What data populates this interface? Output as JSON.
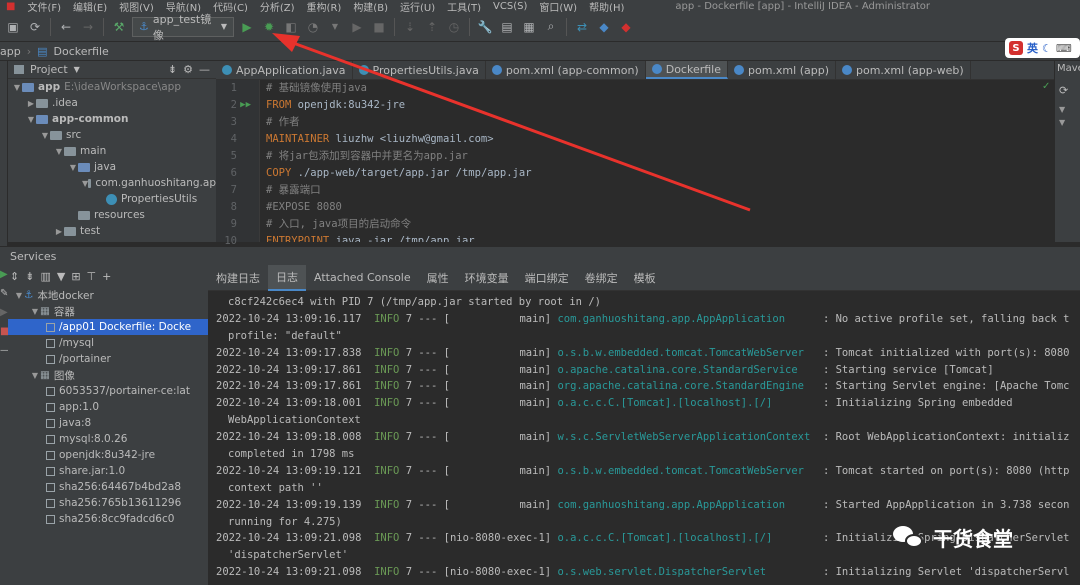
{
  "menu": {
    "items": [
      "文件(F)",
      "编辑(E)",
      "视图(V)",
      "导航(N)",
      "代码(C)",
      "分析(Z)",
      "重构(R)",
      "构建(B)",
      "运行(U)",
      "工具(T)",
      "VCS(S)",
      "窗口(W)",
      "帮助(H)"
    ],
    "window_title": "app - Dockerfile [app] - IntelliJ IDEA - Administrator"
  },
  "toolbar": {
    "run_config": "app_test镜像",
    "icons": [
      "save-icon",
      "sync-icon",
      "back-icon",
      "forward-icon",
      "build-icon",
      "run-icon",
      "debug-icon",
      "coverage-icon",
      "profile-icon",
      "stop-icon",
      "vcs-icon",
      "settings-icon",
      "structure-icon",
      "search-icon"
    ]
  },
  "breadcrumb": {
    "items": [
      "app",
      "Dockerfile"
    ]
  },
  "project": {
    "title": "Project",
    "tree": [
      {
        "label": "app",
        "extra": "E:\\ideaWorkspace\\app",
        "indent": 0,
        "open": true,
        "type": "folder-blue",
        "bold": true
      },
      {
        "label": ".idea",
        "indent": 1,
        "open": false,
        "type": "folder"
      },
      {
        "label": "app-common",
        "indent": 1,
        "open": true,
        "type": "folder-blue",
        "bold": true
      },
      {
        "label": "src",
        "indent": 2,
        "open": true,
        "type": "folder"
      },
      {
        "label": "main",
        "indent": 3,
        "open": true,
        "type": "folder"
      },
      {
        "label": "java",
        "indent": 4,
        "open": true,
        "type": "folder-blue"
      },
      {
        "label": "com.ganhuoshitang.ap",
        "indent": 5,
        "open": true,
        "type": "folder"
      },
      {
        "label": "PropertiesUtils",
        "indent": 6,
        "open": null,
        "type": "class"
      },
      {
        "label": "resources",
        "indent": 4,
        "open": null,
        "type": "folder"
      },
      {
        "label": "test",
        "indent": 3,
        "open": false,
        "type": "folder"
      }
    ]
  },
  "editor": {
    "tabs": [
      {
        "label": "AppApplication.java",
        "active": false,
        "color": "#3d8fb5"
      },
      {
        "label": "PropertiesUtils.java",
        "active": false,
        "color": "#3d8fb5"
      },
      {
        "label": "pom.xml (app-common)",
        "active": false,
        "color": "#4a88c7"
      },
      {
        "label": "Dockerfile",
        "active": true,
        "color": "#4a88c7"
      },
      {
        "label": "pom.xml (app)",
        "active": false,
        "color": "#4a88c7"
      },
      {
        "label": "pom.xml (app-web)",
        "active": false,
        "color": "#4a88c7"
      }
    ],
    "right_label": "Mave",
    "lines": [
      {
        "n": "1",
        "parts": [
          {
            "c": "cm",
            "t": "# 基础镜像使用java"
          }
        ]
      },
      {
        "n": "2",
        "run": true,
        "parts": [
          {
            "c": "kw",
            "t": "FROM"
          },
          {
            "c": "tx",
            "t": " openjdk:8u342-jre"
          }
        ]
      },
      {
        "n": "3",
        "parts": [
          {
            "c": "cm",
            "t": "# 作者"
          }
        ]
      },
      {
        "n": "4",
        "parts": [
          {
            "c": "kw",
            "t": "MAINTAINER"
          },
          {
            "c": "tx",
            "t": " liuzhw <liuzhw@gmail.com>"
          }
        ]
      },
      {
        "n": "5",
        "parts": [
          {
            "c": "cm",
            "t": "# 将jar包添加到容器中并更名为app.jar"
          }
        ]
      },
      {
        "n": "6",
        "parts": [
          {
            "c": "kw",
            "t": "COPY"
          },
          {
            "c": "tx",
            "t": " ./app-web/target/app.jar /tmp/app.jar"
          }
        ]
      },
      {
        "n": "7",
        "parts": [
          {
            "c": "cm",
            "t": "# 暴露端口"
          }
        ]
      },
      {
        "n": "8",
        "parts": [
          {
            "c": "cm",
            "t": "#EXPOSE 8080"
          }
        ]
      },
      {
        "n": "9",
        "parts": [
          {
            "c": "cm",
            "t": "# 入口, java项目的启动命令"
          }
        ]
      },
      {
        "n": "10",
        "parts": [
          {
            "c": "kw",
            "t": "ENTRYPOINT"
          },
          {
            "c": "tx",
            "t": " java -jar /tmp/app.jar"
          }
        ]
      }
    ]
  },
  "services": {
    "title": "Services",
    "tree": [
      {
        "label": "本地docker",
        "indent": 0,
        "type": "docker"
      },
      {
        "label": "容器",
        "indent": 1,
        "type": "group"
      },
      {
        "label": "/app01 Dockerfile: Docke",
        "indent": 2,
        "type": "item",
        "selected": true
      },
      {
        "label": "/mysql",
        "indent": 2,
        "type": "item"
      },
      {
        "label": "/portainer",
        "indent": 2,
        "type": "item"
      },
      {
        "label": "图像",
        "indent": 1,
        "type": "group"
      },
      {
        "label": "6053537/portainer-ce:lat",
        "indent": 2,
        "type": "item"
      },
      {
        "label": "app:1.0",
        "indent": 2,
        "type": "item"
      },
      {
        "label": "java:8",
        "indent": 2,
        "type": "item"
      },
      {
        "label": "mysql:8.0.26",
        "indent": 2,
        "type": "item"
      },
      {
        "label": "openjdk:8u342-jre",
        "indent": 2,
        "type": "item"
      },
      {
        "label": "share.jar:1.0",
        "indent": 2,
        "type": "item"
      },
      {
        "label": "sha256:64467b4bd2a8",
        "indent": 2,
        "type": "item"
      },
      {
        "label": "sha256:765b13611296",
        "indent": 2,
        "type": "item"
      },
      {
        "label": "sha256:8cc9fadcd6c0",
        "indent": 2,
        "type": "item"
      }
    ],
    "tabs": [
      {
        "label": "构建日志",
        "active": false
      },
      {
        "label": "日志",
        "active": true
      },
      {
        "label": "Attached Console",
        "active": false
      },
      {
        "label": "属性",
        "active": false
      },
      {
        "label": "环境变量",
        "active": false
      },
      {
        "label": "端口绑定",
        "active": false
      },
      {
        "label": "卷绑定",
        "active": false
      },
      {
        "label": "模板",
        "active": false
      }
    ],
    "log": [
      {
        "t": "c8cf242c6ec4 with PID 7 (/tmp/app.jar started by root in /)",
        "cont": true
      },
      {
        "ts": "2022-10-24 13:09:16.117",
        "lvl": "INFO",
        "pid": "7 --- [",
        "th": "           main]",
        "cls": "com.ganhuoshitang.app.AppApplication     ",
        "msg": ": No active profile set, falling back t"
      },
      {
        "t": "profile: \"default\"",
        "cont": true
      },
      {
        "ts": "2022-10-24 13:09:17.838",
        "lvl": "INFO",
        "pid": "7 --- [",
        "th": "           main]",
        "cls": "o.s.b.w.embedded.tomcat.TomcatWebServer  ",
        "msg": ": Tomcat initialized with port(s): 8080"
      },
      {
        "ts": "2022-10-24 13:09:17.861",
        "lvl": "INFO",
        "pid": "7 --- [",
        "th": "           main]",
        "cls": "o.apache.catalina.core.StandardService   ",
        "msg": ": Starting service [Tomcat]"
      },
      {
        "ts": "2022-10-24 13:09:17.861",
        "lvl": "INFO",
        "pid": "7 --- [",
        "th": "           main]",
        "cls": "org.apache.catalina.core.StandardEngine  ",
        "msg": ": Starting Servlet engine: [Apache Tomc"
      },
      {
        "ts": "2022-10-24 13:09:18.001",
        "lvl": "INFO",
        "pid": "7 --- [",
        "th": "           main]",
        "cls": "o.a.c.c.C.[Tomcat].[localhost].[/]       ",
        "msg": ": Initializing Spring embedded"
      },
      {
        "t": "WebApplicationContext",
        "cont": true
      },
      {
        "ts": "2022-10-24 13:09:18.008",
        "lvl": "INFO",
        "pid": "7 --- [",
        "th": "           main]",
        "cls": "w.s.c.ServletWebServerApplicationContext ",
        "msg": ": Root WebApplicationContext: initializ"
      },
      {
        "t": "completed in 1798 ms",
        "cont": true
      },
      {
        "ts": "2022-10-24 13:09:19.121",
        "lvl": "INFO",
        "pid": "7 --- [",
        "th": "           main]",
        "cls": "o.s.b.w.embedded.tomcat.TomcatWebServer  ",
        "msg": ": Tomcat started on port(s): 8080 (http"
      },
      {
        "t": "context path ''",
        "cont": true
      },
      {
        "ts": "2022-10-24 13:09:19.139",
        "lvl": "INFO",
        "pid": "7 --- [",
        "th": "           main]",
        "cls": "com.ganhuoshitang.app.AppApplication     ",
        "msg": ": Started AppApplication in 3.738 secon"
      },
      {
        "t": "running for 4.275)",
        "cont": true
      },
      {
        "ts": "2022-10-24 13:09:21.098",
        "lvl": "INFO",
        "pid": "7 --- [",
        "th": "nio-8080-exec-1]",
        "cls": "o.a.c.c.C.[Tomcat].[localhost].[/]       ",
        "msg": ": Initializing Spring DispatcherServlet"
      },
      {
        "t": "'dispatcherServlet'",
        "cont": true
      },
      {
        "ts": "2022-10-24 13:09:21.098",
        "lvl": "INFO",
        "pid": "7 --- [",
        "th": "nio-8080-exec-1]",
        "cls": "o.s.web.servlet.DispatcherServlet        ",
        "msg": ": Initializing Servlet 'dispatcherServl"
      }
    ]
  },
  "watermark": {
    "text": "干货食堂"
  },
  "ime": {
    "text": "英"
  },
  "colors": {
    "accent": "#4a88c7",
    "selection": "#2f65ca",
    "arrow": "#e8322c"
  }
}
